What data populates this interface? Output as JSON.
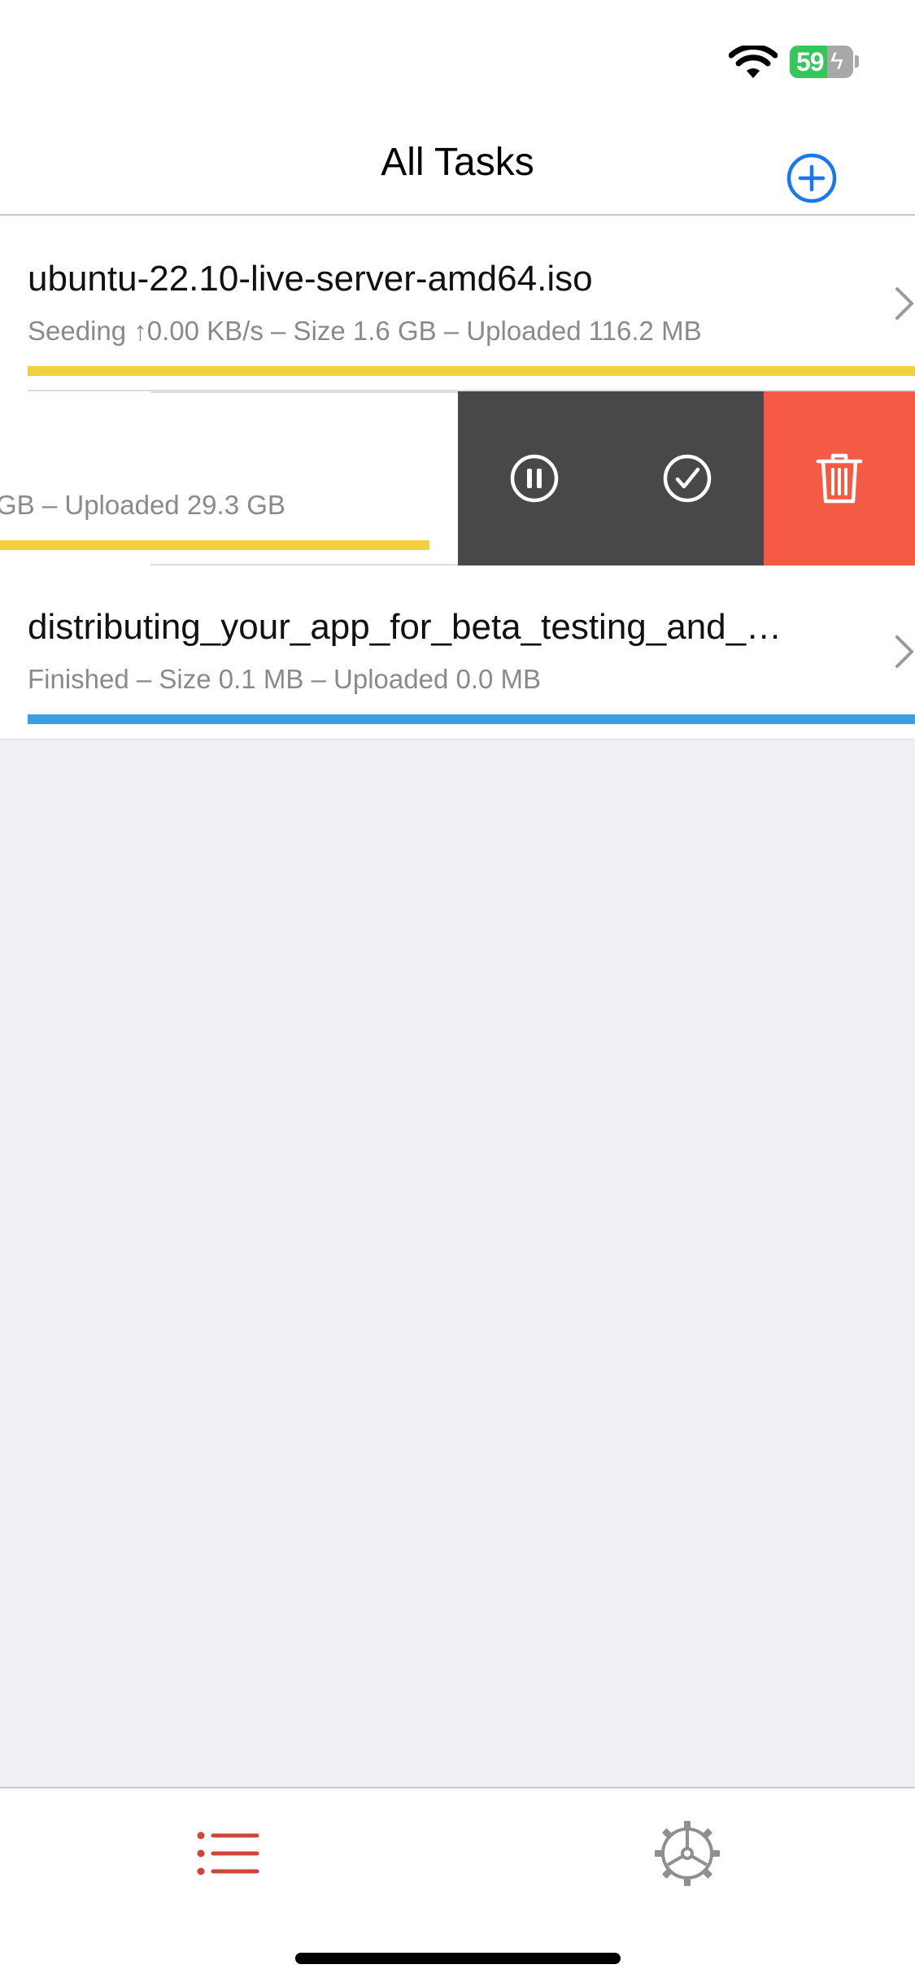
{
  "status_bar": {
    "battery_percent": "59",
    "battery_level": 0.59,
    "battery_charging": true
  },
  "nav": {
    "title": "All Tasks",
    "add_icon": "plus-circle-icon"
  },
  "tasks": [
    {
      "name": "ubuntu-22.10-live-server-amd64.iso",
      "status": "Seeding ↑0.00 KB/s – Size 1.6 GB – Uploaded 116.2 MB",
      "progress": 1.0,
      "progress_color": "#f3d03e"
    },
    {
      "name": "",
      "status": "GB – Uploaded 29.3 GB",
      "progress": 1.0,
      "progress_color": "#f3d03e"
    },
    {
      "name": "distributing_your_app_for_beta_testing_and_…",
      "status": "Finished – Size 0.1 MB – Uploaded 0.0 MB",
      "progress": 1.0,
      "progress_color": "#3b9fe3"
    }
  ],
  "swipe_actions": [
    {
      "icon": "pause-circle-icon",
      "color": "#48484a"
    },
    {
      "icon": "checkmark-circle-icon",
      "color": "#48484a"
    },
    {
      "icon": "trash-icon",
      "color": "#f45a44"
    }
  ],
  "tab_bar": {
    "items": [
      {
        "icon": "list-icon",
        "selected": true,
        "color": "#d0453a"
      },
      {
        "icon": "gear-icon",
        "selected": false,
        "color": "#8e8e93"
      }
    ]
  },
  "colors": {
    "accent_blue": "#1877f2",
    "seeding_yellow": "#f3d03e",
    "finished_blue": "#3b9fe3",
    "delete_red": "#f45a44",
    "background_gray": "#efeff4"
  }
}
